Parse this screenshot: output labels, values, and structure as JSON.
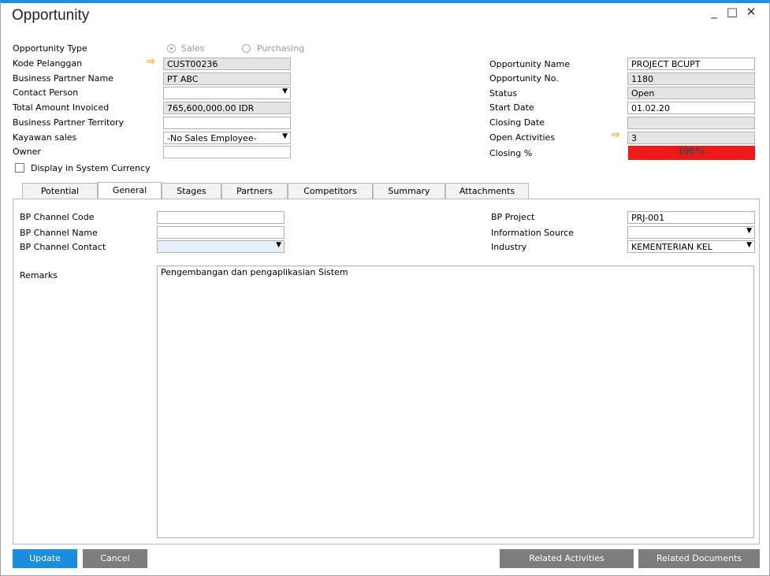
{
  "window": {
    "title": "Opportunity",
    "minimize": "_",
    "maximize": "□",
    "close": "✕"
  },
  "header_left": {
    "opportunity_type_label": "Opportunity Type",
    "radio_sales": "Sales",
    "radio_purchasing": "Purchasing",
    "kode_pelanggan_label": "Kode Pelanggan",
    "kode_pelanggan_value": "CUST00236",
    "bp_name_label": "Business Partner Name",
    "bp_name_value": "PT ABC",
    "contact_person_label": "Contact Person",
    "contact_person_value": "",
    "total_invoiced_label": "Total Amount Invoiced",
    "total_invoiced_value": "765,600,000.00 IDR",
    "bp_territory_label": "Business Partner Territory",
    "bp_territory_value": "",
    "kayawan_label": "Kayawan sales",
    "kayawan_value": "-No Sales Employee-",
    "owner_label": "Owner",
    "owner_value": "",
    "display_currency_label": "Display in System Currency"
  },
  "header_right": {
    "opp_name_label": "Opportunity Name",
    "opp_name_value": "PROJECT BCUPT",
    "opp_no_label": "Opportunity No.",
    "opp_no_value": "1180",
    "status_label": "Status",
    "status_value": "Open",
    "start_date_label": "Start Date",
    "start_date_value": "01.02.20",
    "closing_date_label": "Closing Date",
    "closing_date_value": "",
    "open_activities_label": "Open Activities",
    "open_activities_value": "3",
    "closing_pct_label": "Closing %",
    "closing_pct_value": "100%"
  },
  "tabs": [
    "Potential",
    "General",
    "Stages",
    "Partners",
    "Competitors",
    "Summary",
    "Attachments"
  ],
  "general": {
    "bp_channel_code_label": "BP Channel Code",
    "bp_channel_code_value": "",
    "bp_channel_name_label": "BP Channel Name",
    "bp_channel_name_value": "",
    "bp_channel_contact_label": "BP Channel Contact",
    "bp_channel_contact_value": "",
    "bp_project_label": "BP Project",
    "bp_project_value": "PRJ-001",
    "info_source_label": "Information Source",
    "info_source_value": "",
    "industry_label": "Industry",
    "industry_value": "KEMENTERIAN KEL",
    "remarks_label": "Remarks",
    "remarks_value": "Pengembangan dan pengaplikasian Sistem"
  },
  "buttons": {
    "update": "Update",
    "cancel": "Cancel",
    "related_activities": "Related Activities",
    "related_documents": "Related Documents"
  },
  "colors": {
    "accent": "#1c8fe0",
    "closing_bar": "#ee1a1a",
    "arrow": "#e9a400"
  }
}
